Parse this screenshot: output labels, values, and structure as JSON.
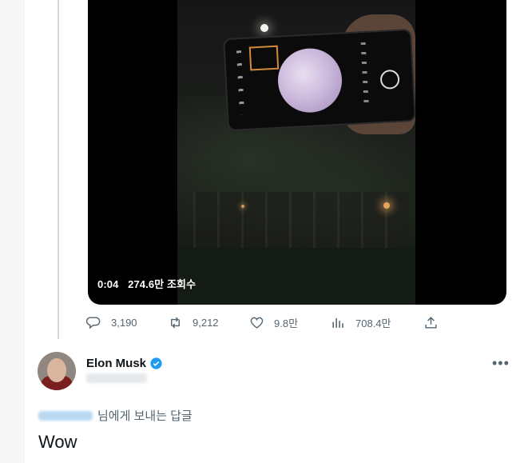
{
  "video": {
    "time": "0:04",
    "views": "274.6만 조회수"
  },
  "actions": {
    "reply_count": "3,190",
    "retweet_count": "9,212",
    "like_count": "9.8만",
    "view_count": "708.4만"
  },
  "reply": {
    "author_name": "Elon Musk",
    "replying_to_suffix": "님에게 보내는 답글",
    "text": "Wow"
  },
  "colors": {
    "verified": "#1d9bf0",
    "icon_gray": "#536471",
    "text": "#0f1419"
  },
  "icons": [
    "reply-icon",
    "retweet-icon",
    "like-icon",
    "views-icon",
    "share-icon",
    "verified-badge-icon",
    "more-icon"
  ]
}
